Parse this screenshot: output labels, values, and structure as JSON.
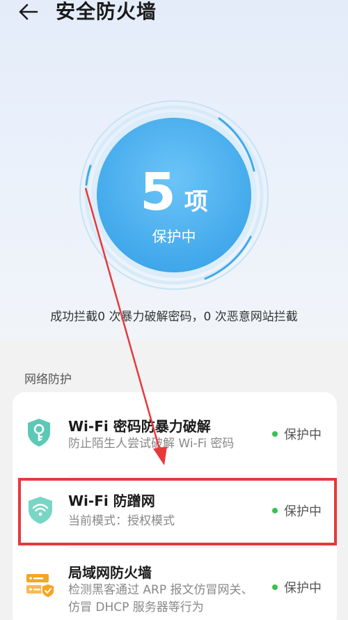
{
  "header": {
    "title": "安全防火墙"
  },
  "summary": {
    "count": "5",
    "unit": "项",
    "status": "保护中"
  },
  "intercept_text": "成功拦截0 次暴力破解密码，0 次恶意网站拦截",
  "network": {
    "section_title": "网络防护",
    "items": [
      {
        "title": "Wi-Fi 密码防暴力破解",
        "desc": "防止陌生人尝试破解 Wi-Fi 密码",
        "status": "保护中",
        "icon": "key-shield-icon"
      },
      {
        "title": "Wi-Fi 防蹭网",
        "desc": "当前模式：授权模式",
        "status": "保护中",
        "icon": "wifi-shield-icon"
      },
      {
        "title": "局域网防火墙",
        "desc": "检测黑客通过 ARP 报文仿冒网关、仿冒 DHCP 服务器等行为",
        "status": "保护中",
        "icon": "firewall-icon"
      }
    ]
  },
  "colors": {
    "accent": "#3ea9ec",
    "status_dot": "#37c24f",
    "annotation": "#e8383b",
    "icon_teal": "#5cc9b7",
    "icon_orange": "#f5a623"
  }
}
